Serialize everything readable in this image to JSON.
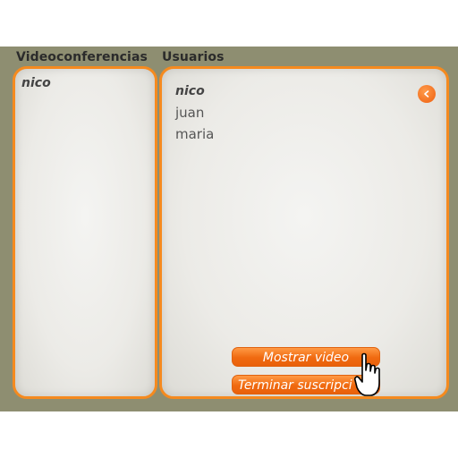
{
  "header": {
    "tab_videoconferences": "Videoconferencias",
    "tab_users": "Usuarios"
  },
  "left_panel": {
    "current_user": "nico"
  },
  "right_panel": {
    "users": [
      "nico",
      "juan",
      "maria"
    ],
    "back_icon": "chevron-left-icon",
    "show_video_label": "Mostrar video",
    "end_subscription_label": "Terminar suscripci"
  },
  "colors": {
    "accent": "#f58a1f",
    "background": "#8e8e71"
  },
  "cursor_icon": "hand-pointer-icon"
}
